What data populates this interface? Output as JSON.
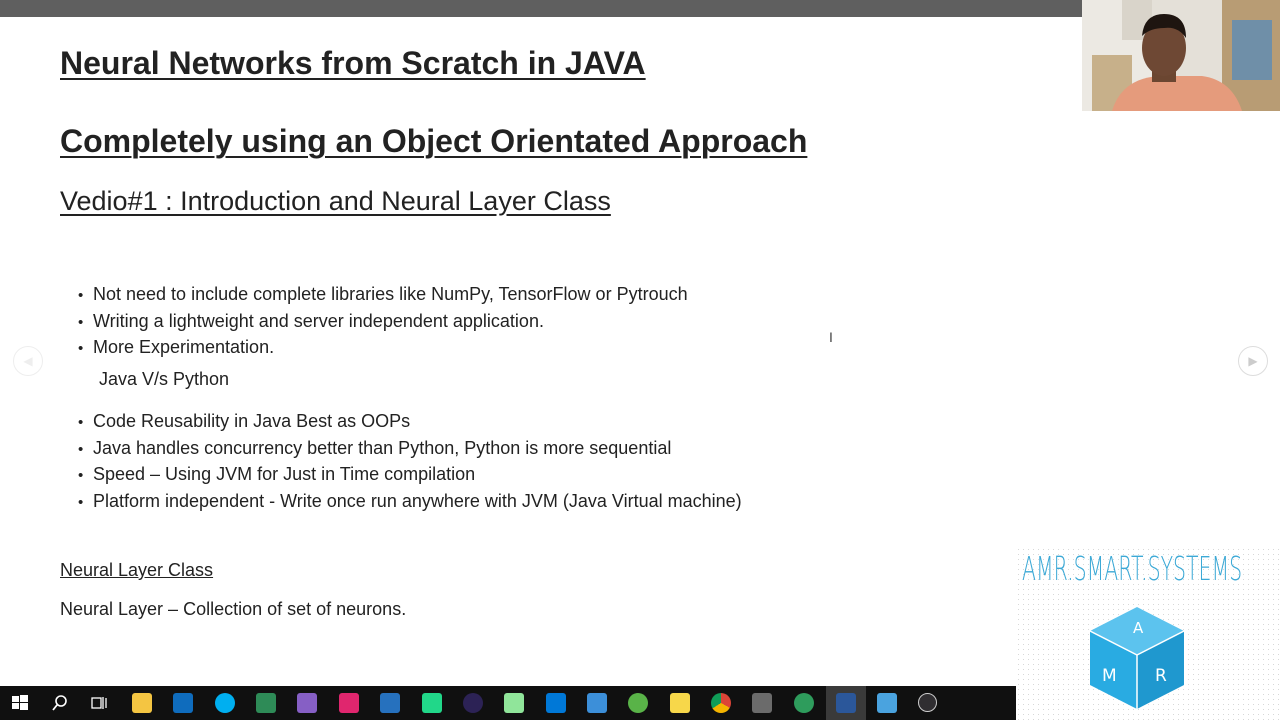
{
  "slide": {
    "title_line1": "Neural Networks from Scratch in JAVA",
    "title_line2": "Completely using an Object Orientated Approach",
    "subtitle": "Vedio#1 : Introduction and Neural Layer Class",
    "bullets_group1": [
      "Not need to include complete libraries like NumPy, TensorFlow or Pytrouch",
      "Writing a lightweight and server independent application.",
      "More Experimentation."
    ],
    "subheading": "Java V/s Python",
    "bullets_group2": [
      "Code Reusability in Java Best as OOPs",
      "Java handles concurrency better than Python, Python is more sequential",
      "Speed – Using JVM for Just in Time compilation",
      "Platform independent - Write once run anywhere with JVM (Java Virtual machine)"
    ],
    "section_heading": "Neural Layer Class",
    "section_text": "Neural Layer – Collection of set of neurons."
  },
  "logo": {
    "text": "AMR.SMART.SYSTEMS",
    "cube_letters": [
      "A",
      "M",
      "R"
    ],
    "color": "#29abe2"
  },
  "taskbar": {
    "icons": [
      "windows-start-icon",
      "search-icon",
      "task-view-icon",
      "file-explorer-icon",
      "outlook-icon",
      "skype-icon",
      "app-icon",
      "visual-studio-icon",
      "intellij-icon",
      "powershell-icon",
      "pycharm-icon",
      "eclipse-icon",
      "notepad-plus-icon",
      "app-icon",
      "settings-icon",
      "download-icon",
      "sticky-icon",
      "chrome-icon",
      "media-icon",
      "globe-icon",
      "word-icon",
      "remote-desktop-icon",
      "obs-icon"
    ]
  },
  "colors": {
    "top_bar": "#5f5f5f",
    "taskbar": "#101010",
    "text": "#222222"
  }
}
